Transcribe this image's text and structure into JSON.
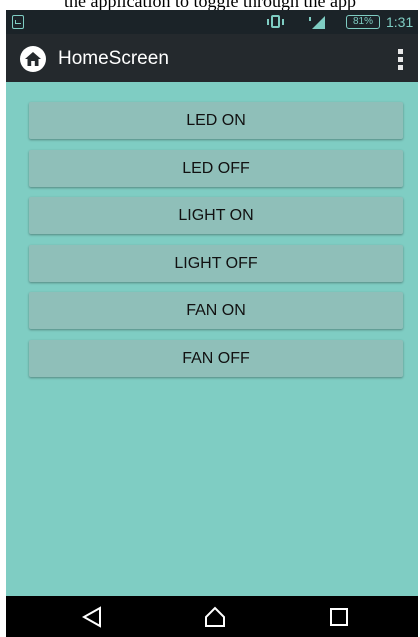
{
  "caption": {
    "text": "the application to toggle through the app"
  },
  "status_bar": {
    "battery": "81%",
    "time": "1:31"
  },
  "app_bar": {
    "title": "HomeScreen"
  },
  "buttons": [
    {
      "label": "LED ON"
    },
    {
      "label": "LED OFF"
    },
    {
      "label": "LIGHT ON"
    },
    {
      "label": "LIGHT OFF"
    },
    {
      "label": "FAN ON"
    },
    {
      "label": "FAN OFF"
    }
  ],
  "icons": {
    "notification": "notification-icon",
    "vibrate": "vibrate-icon",
    "signal": "signal-icon",
    "battery": "battery-icon",
    "app": "home-icon",
    "overflow": "more-vertical-icon",
    "back": "back-icon",
    "home": "home-nav-icon",
    "recents": "recents-icon"
  },
  "colors": {
    "background": "#7fcdc3",
    "button": "#8fbfb9",
    "app_bar": "#24292d",
    "status_bar": "#1b2328",
    "nav_bar": "#000000"
  }
}
